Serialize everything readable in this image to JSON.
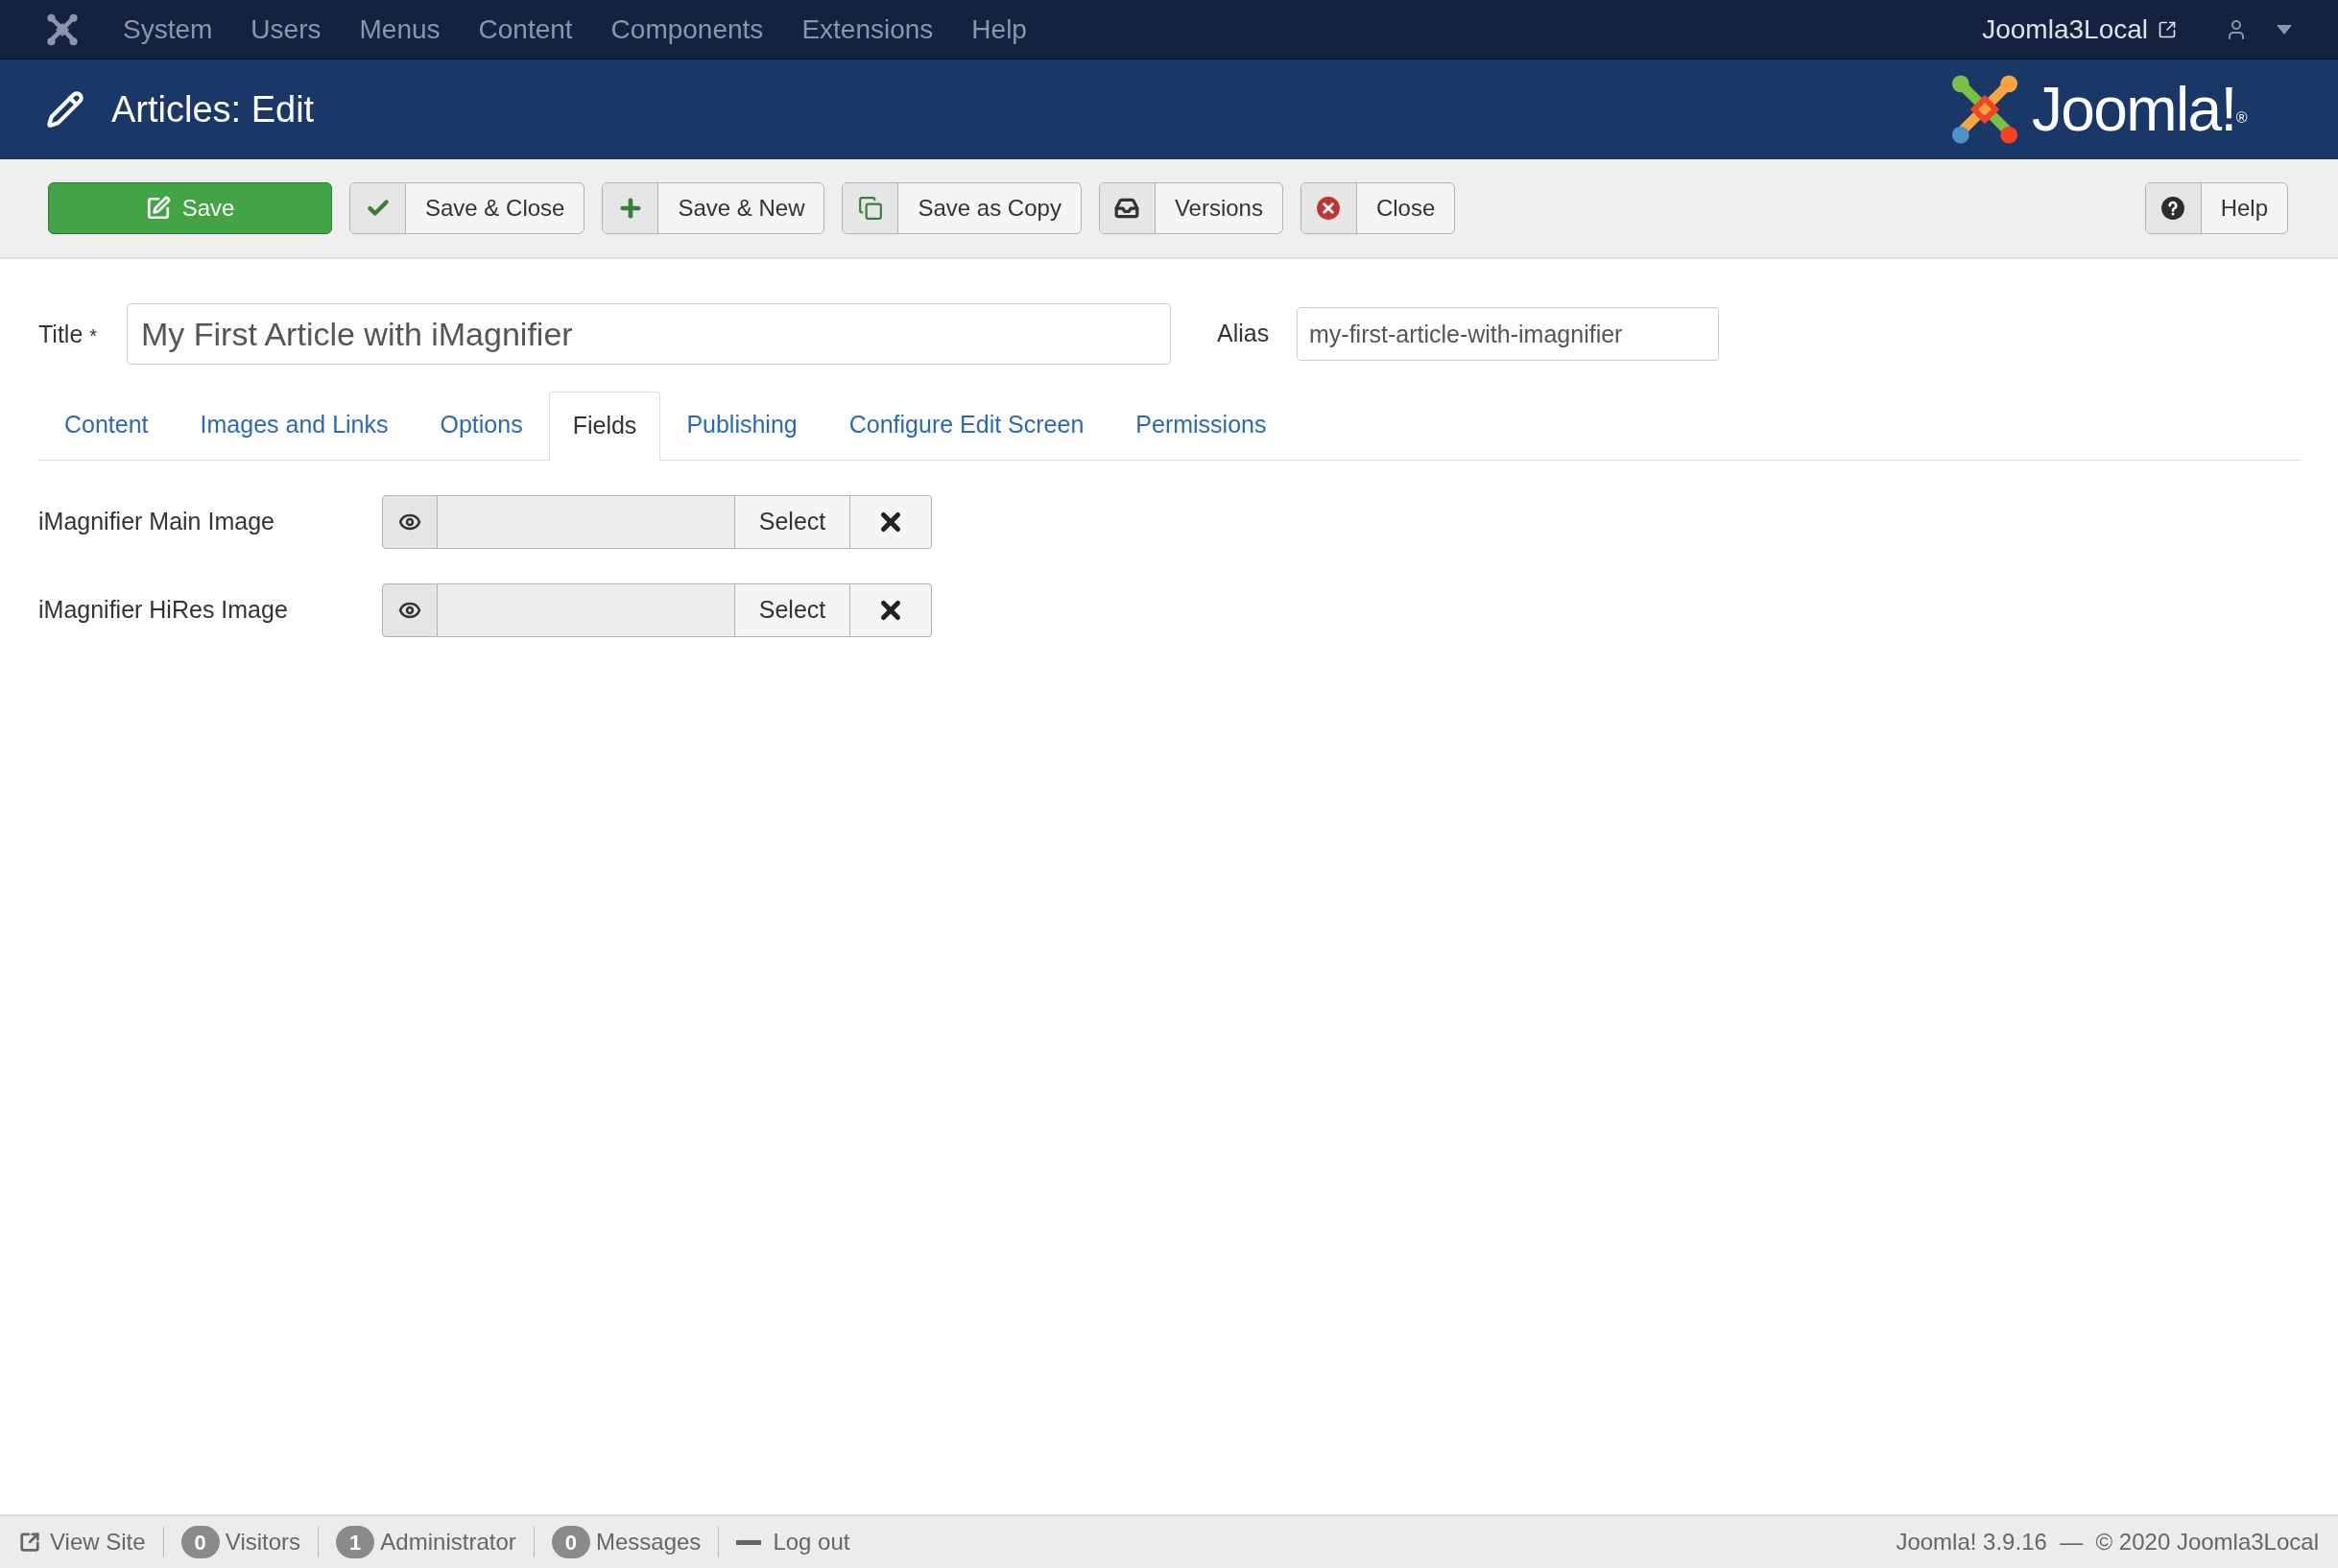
{
  "top_menu": {
    "items": [
      "System",
      "Users",
      "Menus",
      "Content",
      "Components",
      "Extensions",
      "Help"
    ],
    "site_link": "Joomla3Local"
  },
  "header": {
    "title": "Articles: Edit",
    "logo": "Joomla!",
    "logo_mark": "®"
  },
  "toolbar": {
    "buttons": [
      {
        "kind": "primary",
        "label": "Save"
      },
      {
        "kind": "check",
        "label": "Save & Close"
      },
      {
        "kind": "plus",
        "label": "Save & New"
      },
      {
        "kind": "copy",
        "label": "Save as Copy"
      },
      {
        "kind": "versions",
        "label": "Versions"
      },
      {
        "kind": "cancel",
        "label": "Close"
      }
    ],
    "help": {
      "label": "Help"
    }
  },
  "form": {
    "title_label": "Title",
    "required_mark": "*",
    "title_value": "My First Article with iMagnifier",
    "alias_label": "Alias",
    "alias_value": "my-first-article-with-imagnifier"
  },
  "tabs": [
    {
      "label": "Content",
      "selected": false
    },
    {
      "label": "Images and Links",
      "selected": false
    },
    {
      "label": "Options",
      "selected": false
    },
    {
      "label": "Fields",
      "selected": true
    },
    {
      "label": "Publishing",
      "selected": false
    },
    {
      "label": "Configure Edit Screen",
      "selected": false
    },
    {
      "label": "Permissions",
      "selected": false
    }
  ],
  "fields": [
    {
      "label": "iMagnifier Main Image",
      "button": "Select"
    },
    {
      "label": "iMagnifier HiRes Image",
      "button": "Select"
    }
  ],
  "status_bar": {
    "items": [
      {
        "kind": "link",
        "label": "View Site"
      },
      {
        "kind": "count",
        "count": "0",
        "label": "Visitors"
      },
      {
        "kind": "count",
        "count": "1",
        "label": "Administrator"
      },
      {
        "kind": "count",
        "count": "0",
        "label": "Messages"
      },
      {
        "kind": "logout",
        "label": "Log out"
      }
    ],
    "version": "Joomla! 3.9.16  —  © 2020 Joomla3Local"
  }
}
